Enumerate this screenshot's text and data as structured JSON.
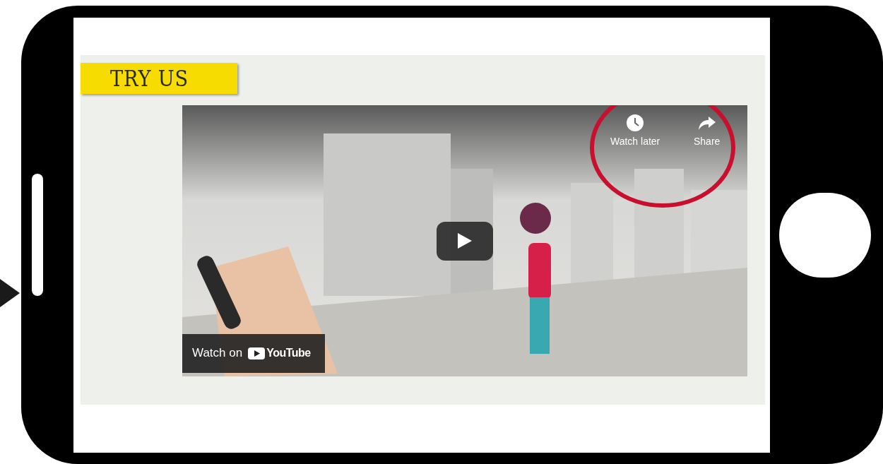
{
  "banner": {
    "title": "TRY US"
  },
  "video": {
    "kind": "picture",
    "watch_later": "Watch later",
    "share": "Share",
    "watch_on": "Watch on",
    "brand": "YouTube"
  }
}
